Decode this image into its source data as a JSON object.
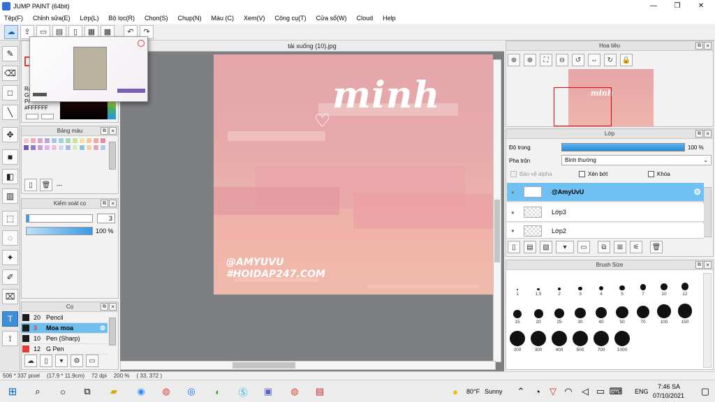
{
  "window": {
    "title": "JUMP PAINT (64bit)",
    "minimize": "—",
    "restore": "❐",
    "close": "✕"
  },
  "menu": [
    "Tệp(F)",
    "Chỉnh sửa(E)",
    "Lớp(L)",
    "Bộ lọc(R)",
    "Chọn(S)",
    "Chụp(N)",
    "Màu (C)",
    "Xem(V)",
    "Công cụ(T)",
    "Cửa sổ(W)",
    "Cloud",
    "Help"
  ],
  "document": {
    "tab_title": "tải xuống (10).jpg"
  },
  "artwork": {
    "script_text": "minh",
    "handle_line1": "@AMYUVU",
    "handle_line2": "#HOIDAP247.COM"
  },
  "color_panel": {
    "text1": "Ra",
    "text2": "Gi",
    "text3": "Pi",
    "hex": "#FFFFFF"
  },
  "palette_panel": {
    "title": "Bảng màu",
    "more": "---"
  },
  "stroke_panel": {
    "title": "Kiểm soát cọ",
    "size_value": "3",
    "opacity_value": "100 %"
  },
  "brush_panel": {
    "title": "Cọ",
    "brushes": [
      {
        "size": "20",
        "name": "Pencil",
        "selected": false
      },
      {
        "size": "3",
        "name": "Moa moa",
        "selected": true
      },
      {
        "size": "10",
        "name": "Pen (Sharp)",
        "selected": false
      },
      {
        "size": "12",
        "name": "G Pen",
        "selected": false
      }
    ]
  },
  "navigator": {
    "title": "Hoa tiêu",
    "preview_text": "minh"
  },
  "layers": {
    "title": "Lớp",
    "opacity_label": "Độ trong",
    "opacity_value": "100 %",
    "opacity_fraction": 1.0,
    "blend_label": "Pha trộn",
    "blend_value": "Bình thường",
    "protect_alpha": "Bảo vệ alpha",
    "clipping": "Xén bớt",
    "lock": "Khóa",
    "items": [
      {
        "name": "@AmyUvU",
        "selected": true
      },
      {
        "name": "Lớp3",
        "selected": false
      },
      {
        "name": "Lớp2",
        "selected": false
      }
    ]
  },
  "brush_size": {
    "title": "Brush Size",
    "sizes": [
      "1",
      "1.5",
      "2",
      "3",
      "4",
      "5",
      "7",
      "10",
      "12",
      "15",
      "20",
      "25",
      "30",
      "40",
      "50",
      "70",
      "100",
      "150",
      "200",
      "300",
      "400",
      "500",
      "700",
      "1000"
    ]
  },
  "status": {
    "pixel_size": "506 * 337 pixel",
    "cm_size": "(17.9 * 11.9cm)",
    "dpi": "72 dpi",
    "zoom": "200 %",
    "coords": "( 33, 372 )"
  },
  "taskbar": {
    "weather_temp": "80°F",
    "weather_text": "Sunny",
    "lang": "ENG",
    "time": "7:46 SA",
    "date": "07/10/2021"
  }
}
